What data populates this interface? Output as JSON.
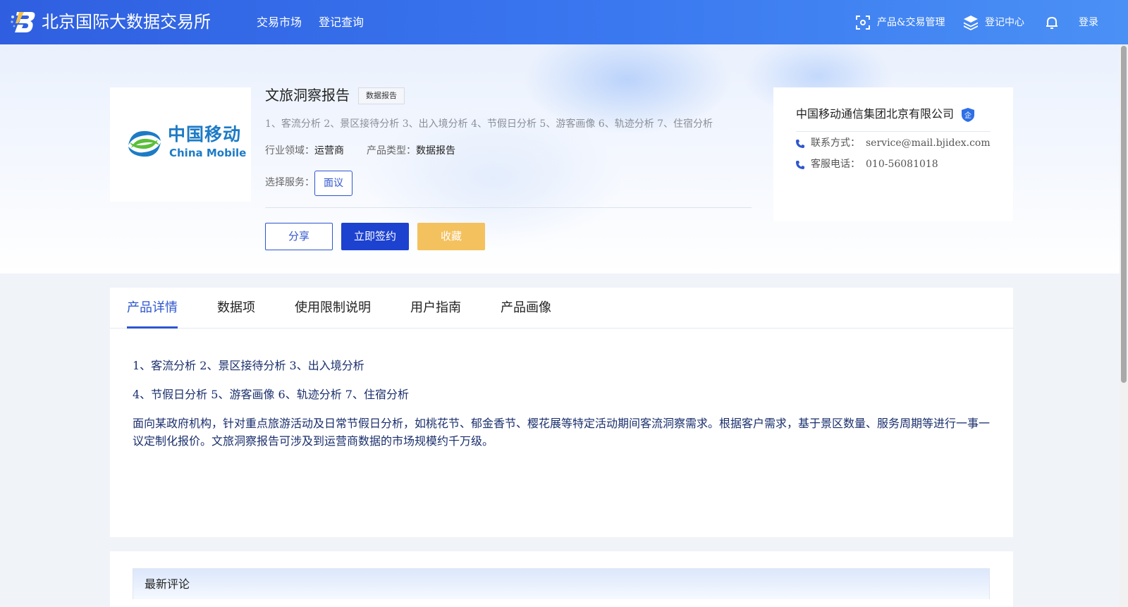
{
  "header": {
    "brand": "北京国际大数据交易所",
    "nav": [
      "交易市场",
      "登记查询"
    ],
    "product_mgmt": "产品&交易管理",
    "register_center": "登记中心",
    "login": "登录",
    "bg_color": "#3a78f0"
  },
  "product": {
    "logo_cn": "中国移动",
    "logo_en": "China Mobile",
    "title": "文旅洞察报告",
    "tag": "数据报告",
    "description": "1、客流分析 2、景区接待分析 3、出入境分析 4、节假日分析 5、游客画像 6、轨迹分析 7、住宿分析",
    "industry_label": "行业领域：",
    "industry": "运营商",
    "type_label": "产品类型：",
    "type": "数据报告",
    "service_label": "选择服务：",
    "service_option": "面议",
    "share": "分享",
    "sign": "立即签约",
    "favorite": "收藏",
    "accent_color": "#1d42d0",
    "favorite_color": "#f4c15f"
  },
  "company": {
    "name": "中国移动通信集团北京有限公司",
    "contact_label": "联系方式：",
    "contact": "service@mail.bjidex.com",
    "phone_label": "客服电话：",
    "phone": "010-56081018",
    "badge_icon": "enterprise-shield-icon",
    "badge_text": "企"
  },
  "tabs": [
    "产品详情",
    "数据项",
    "使用限制说明",
    "用户指南",
    "产品画像"
  ],
  "active_tab": 0,
  "details": {
    "line1": "1、客流分析 2、景区接待分析 3、出入境分析",
    "line2": "4、节假日分析 5、游客画像 6、轨迹分析 7、住宿分析",
    "paragraph": "面向某政府机构，针对重点旅游活动及日常节假日分析，如桃花节、郁金香节、樱花展等特定活动期间客流洞察需求。根据客户需求，基于景区数量、服务周期等进行一事一议定制化报价。文旅洞察报告可涉及到运营商数据的市场规模约千万级。"
  },
  "comments": {
    "title": "最新评论"
  }
}
